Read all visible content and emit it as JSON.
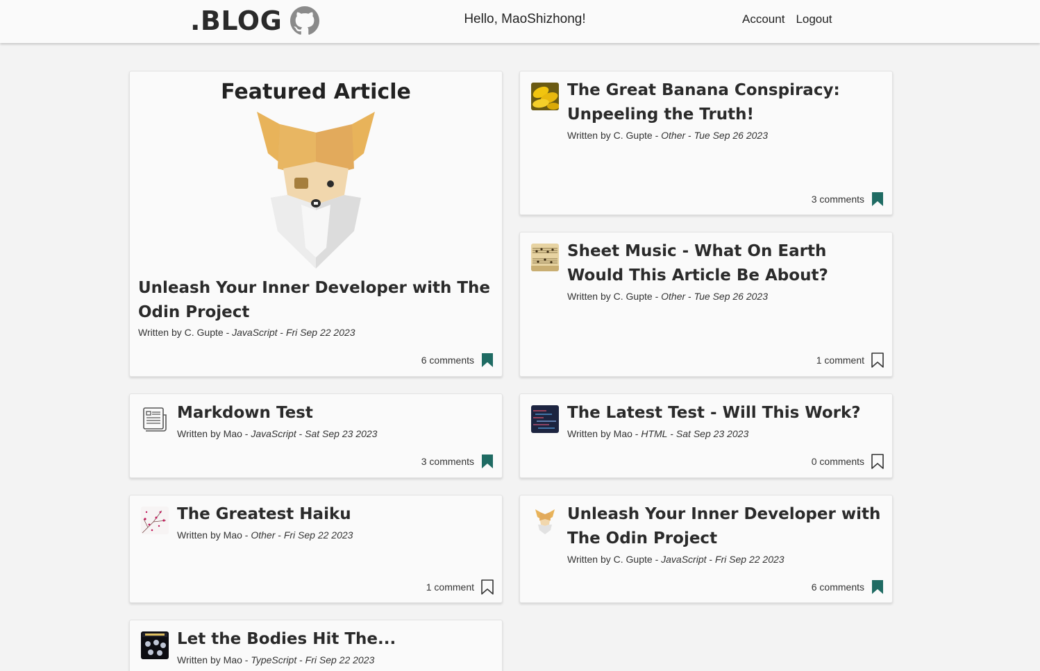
{
  "header": {
    "logo_text": ".BLOG",
    "greeting": "Hello, MaoShizhong!",
    "nav": {
      "account": "Account",
      "logout": "Logout"
    }
  },
  "featured": {
    "heading": "Featured Article",
    "title": "Unleash Your Inner Developer with The Odin Project",
    "author": "C. Gupte",
    "category": "JavaScript",
    "date": "Fri Sep 22 2023",
    "comments": "6 comments",
    "bookmarked": true
  },
  "articles": [
    {
      "title": "The Great Banana Conspiracy: Unpeeling the Truth!",
      "author": "C. Gupte",
      "category": "Other",
      "date": "Tue Sep 26 2023",
      "comments": "3 comments",
      "bookmarked": true,
      "thumb": "banana"
    },
    {
      "title": "Sheet Music - What On Earth Would This Article Be About?",
      "author": "C. Gupte",
      "category": "Other",
      "date": "Tue Sep 26 2023",
      "comments": "1 comment",
      "bookmarked": false,
      "thumb": "sheet-music"
    },
    {
      "title": "Markdown Test",
      "author": "Mao",
      "category": "JavaScript",
      "date": "Sat Sep 23 2023",
      "comments": "3 comments",
      "bookmarked": true,
      "thumb": "document"
    },
    {
      "title": "The Latest Test - Will This Work?",
      "author": "Mao",
      "category": "HTML",
      "date": "Sat Sep 23 2023",
      "comments": "0 comments",
      "bookmarked": false,
      "thumb": "code"
    },
    {
      "title": "The Greatest Haiku",
      "author": "Mao",
      "category": "Other",
      "date": "Fri Sep 22 2023",
      "comments": "1 comment",
      "bookmarked": false,
      "thumb": "blossom"
    },
    {
      "title": "Unleash Your Inner Developer with The Odin Project",
      "author": "C. Gupte",
      "category": "JavaScript",
      "date": "Fri Sep 22 2023",
      "comments": "6 comments",
      "bookmarked": true,
      "thumb": "odin"
    },
    {
      "title": "Let the Bodies Hit The...",
      "author": "Mao",
      "category": "TypeScript",
      "date": "Fri Sep 22 2023",
      "comments": "",
      "bookmarked": false,
      "thumb": "album"
    }
  ],
  "labels": {
    "written_by": "Written by",
    "sep": " - "
  },
  "colors": {
    "bookmark": "#1f6b63",
    "background": "#f3f3f3",
    "card": "#fafafa"
  }
}
